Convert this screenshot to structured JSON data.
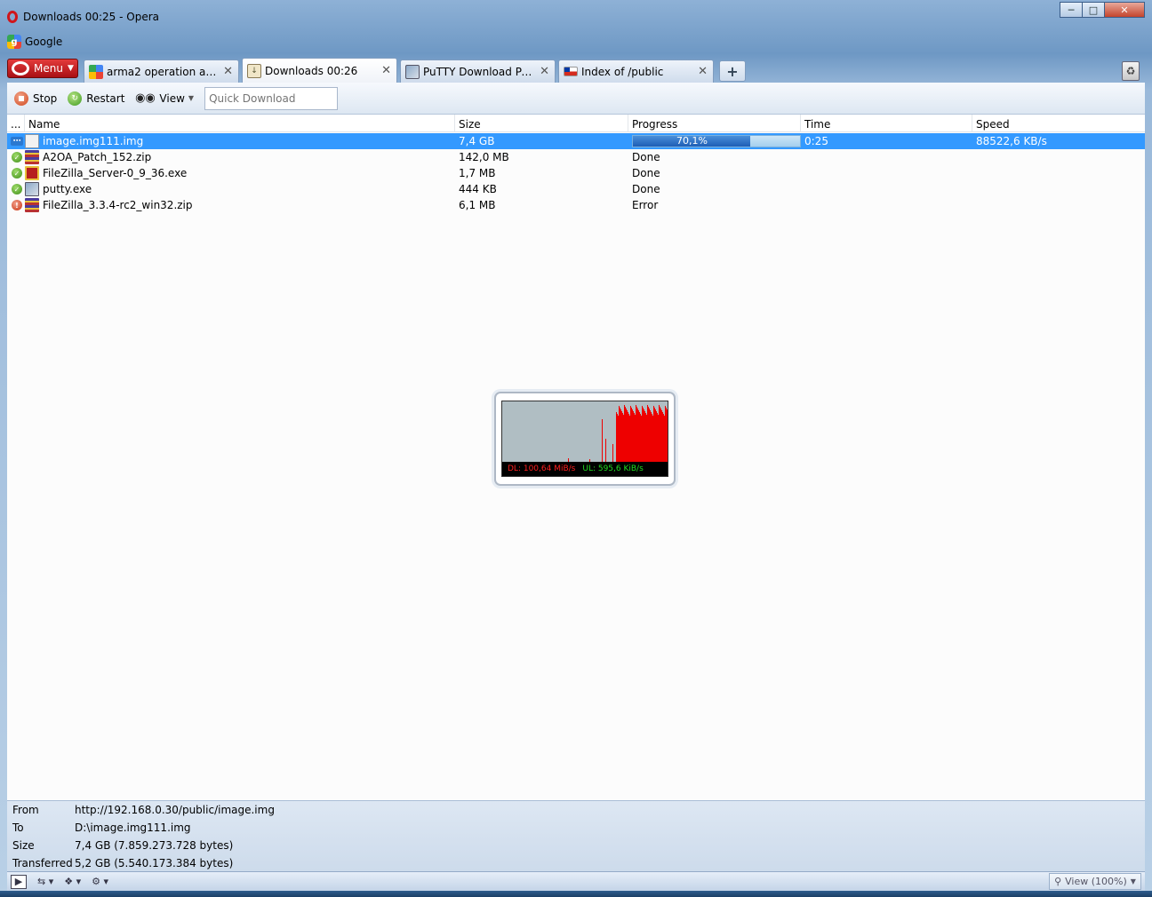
{
  "window": {
    "title": "Downloads 00:25 - Opera",
    "controls": [
      "minimize",
      "maximize",
      "close"
    ]
  },
  "google_bar": {
    "label": "Google"
  },
  "menu": {
    "label": "Menu"
  },
  "tabs": [
    {
      "label": "arma2 operation arrow...",
      "icon": "google-icon",
      "active": false
    },
    {
      "label": "Downloads 00:26",
      "icon": "download-icon",
      "active": true
    },
    {
      "label": "PuTTY Download Page",
      "icon": "putty-icon",
      "active": false
    },
    {
      "label": "Index of /public",
      "icon": "flag-icon",
      "active": false
    }
  ],
  "toolbar": {
    "stop_label": "Stop",
    "restart_label": "Restart",
    "view_label": "View",
    "quick_download_placeholder": "Quick Download"
  },
  "table": {
    "headers": {
      "status": "...",
      "name": "Name",
      "size": "Size",
      "progress": "Progress",
      "time": "Time",
      "speed": "Speed"
    },
    "rows": [
      {
        "status": "downloading",
        "name": "image.img111.img",
        "size": "7,4 GB",
        "progress": "70,1%",
        "progress_value": 0.701,
        "time": "0:25",
        "speed": "88522,6 KB/s",
        "icon": "image-file-icon"
      },
      {
        "status": "done",
        "name": "A2OA_Patch_152.zip",
        "size": "142,0 MB",
        "progress": "Done",
        "time": "",
        "speed": "",
        "icon": "zip-file-icon"
      },
      {
        "status": "done",
        "name": "FileZilla_Server-0_9_36.exe",
        "size": "1,7 MB",
        "progress": "Done",
        "time": "",
        "speed": "",
        "icon": "filezilla-icon"
      },
      {
        "status": "done",
        "name": "putty.exe",
        "size": "444 KB",
        "progress": "Done",
        "time": "",
        "speed": "",
        "icon": "putty-file-icon"
      },
      {
        "status": "error",
        "name": "FileZilla_3.3.4-rc2_win32.zip",
        "size": "6,1 MB",
        "progress": "Error",
        "time": "",
        "speed": "",
        "icon": "zip-file-icon"
      }
    ]
  },
  "widget": {
    "dl_rate": "DL: 100,64 MiB/s",
    "ul_rate": "UL: 595,6 KiB/s"
  },
  "details": {
    "from_label": "From",
    "from_value": "http://192.168.0.30/public/image.img",
    "to_label": "To",
    "to_value": "D:\\image.img111.img",
    "size_label": "Size",
    "size_value": "7,4 GB (7.859.273.728 bytes)",
    "transferred_label": "Transferred",
    "transferred_value": "5,2 GB (5.540.173.384 bytes)"
  },
  "statusbar": {
    "zoom_label": "View (100%)"
  },
  "colors": {
    "selection": "#3399ff",
    "dl_text": "#ff2020",
    "ul_text": "#22dd22",
    "graph_bars": "#ee0000"
  }
}
